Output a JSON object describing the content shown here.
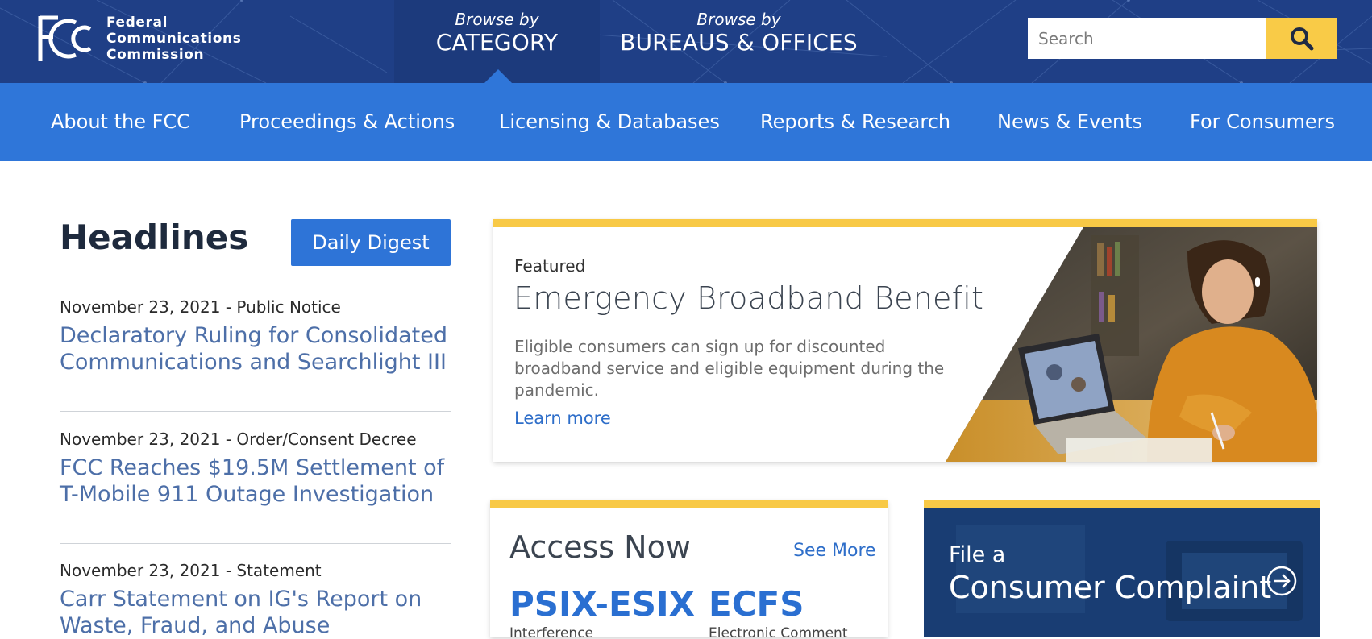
{
  "logo": {
    "line1": "Federal",
    "line2": "Communications",
    "line3": "Commission"
  },
  "browse": {
    "category_pre": "Browse by",
    "category": "CATEGORY",
    "bureaus_pre": "Browse by",
    "bureaus": "BUREAUS & OFFICES"
  },
  "search": {
    "placeholder": "Search",
    "icon": "search-icon"
  },
  "nav": {
    "items": [
      {
        "label": "About the FCC"
      },
      {
        "label": "Proceedings & Actions"
      },
      {
        "label": "Licensing & Databases"
      },
      {
        "label": "Reports & Research"
      },
      {
        "label": "News & Events"
      },
      {
        "label": "For Consumers"
      }
    ]
  },
  "headlines": {
    "title": "Headlines",
    "digest_button": "Daily Digest",
    "items": [
      {
        "meta": "November 23, 2021 - Public Notice",
        "title": "Declaratory Ruling for Consolidated Communications and Searchlight III"
      },
      {
        "meta": "November 23, 2021 - Order/Consent Decree",
        "title": "FCC Reaches $19.5M Settlement of T-Mobile 911 Outage Investigation"
      },
      {
        "meta": "November 23, 2021 - Statement",
        "title": "Carr Statement on IG's Report on Waste, Fraud, and Abuse"
      }
    ]
  },
  "featured": {
    "label": "Featured",
    "title": "Emergency Broadband Benefit",
    "description": "Eligible consumers can sign up for discounted broadband service and eligible equipment during the pandemic.",
    "link": "Learn more"
  },
  "access": {
    "title": "Access Now",
    "see_more": "See More",
    "systems": [
      {
        "name": "PSIX-ESIX",
        "subtitle": "Interference"
      },
      {
        "name": "ECFS",
        "subtitle": "Electronic Comment"
      }
    ]
  },
  "complaint": {
    "pre": "File a",
    "title": "Consumer Complaint",
    "icon": "arrow-circle-right-icon"
  },
  "colors": {
    "header_dark": "#1f3f86",
    "nav_blue": "#2f76d9",
    "accent_yellow": "#f8c946",
    "link_blue": "#4d6fa8"
  }
}
